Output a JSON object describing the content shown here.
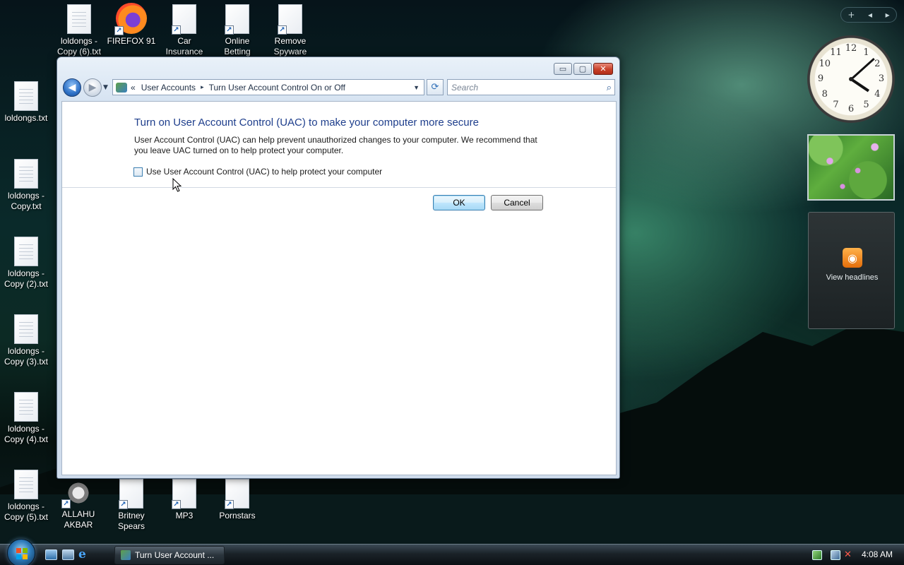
{
  "desktop": {
    "left_icons": [
      {
        "label": "loldongs.txt"
      },
      {
        "label": "loldongs - Copy.txt"
      },
      {
        "label": "loldongs - Copy (2).txt"
      },
      {
        "label": "loldongs - Copy (3).txt"
      },
      {
        "label": "loldongs - Copy (4).txt"
      },
      {
        "label": "loldongs - Copy (5).txt"
      }
    ],
    "top_icons": [
      {
        "label": "loldongs - Copy (6).txt"
      },
      {
        "label": "FIREFOX 91"
      },
      {
        "label": "Car Insurance"
      },
      {
        "label": "Online Betting"
      },
      {
        "label": "Remove Spyware"
      }
    ],
    "bottom_icons": [
      {
        "label": "ALLAHU AKBAR"
      },
      {
        "label": "Britney Spears"
      },
      {
        "label": "MP3"
      },
      {
        "label": "Pornstars"
      }
    ]
  },
  "window": {
    "controls": {
      "minimize": "▭",
      "maximize": "▢",
      "close": "✕"
    },
    "nav": {
      "back": "◀",
      "forward": "▶",
      "recent": "▼"
    },
    "address": {
      "prefix": "«",
      "crumb1": "User Accounts",
      "separator": "▸",
      "crumb2": "Turn User Account Control On or Off",
      "dropdown": "▼"
    },
    "refresh": "⟳",
    "search": {
      "placeholder": "Search",
      "icon": "⌕"
    },
    "content": {
      "heading": "Turn on User Account Control (UAC) to make your computer more secure",
      "description": "User Account Control (UAC) can help prevent unauthorized changes to your computer.  We recommend that you leave UAC turned on to help protect your computer.",
      "checkbox_label": "Use User Account Control (UAC) to help protect your computer",
      "checkbox_checked": false,
      "ok_label": "OK",
      "cancel_label": "Cancel"
    }
  },
  "sidebar": {
    "toolbar": {
      "add": "+",
      "prev": "◂",
      "next": "▸"
    },
    "clock": {
      "numbers": [
        "12",
        "1",
        "2",
        "3",
        "4",
        "5",
        "6",
        "7",
        "8",
        "9",
        "10",
        "11"
      ],
      "hour": 4,
      "minute": 8
    },
    "feeds": {
      "icon": "rss-icon",
      "label": "View headlines"
    }
  },
  "taskbar": {
    "active_task": "Turn User Account ...",
    "time": "4:08 AM",
    "mute_icon": "✕"
  }
}
